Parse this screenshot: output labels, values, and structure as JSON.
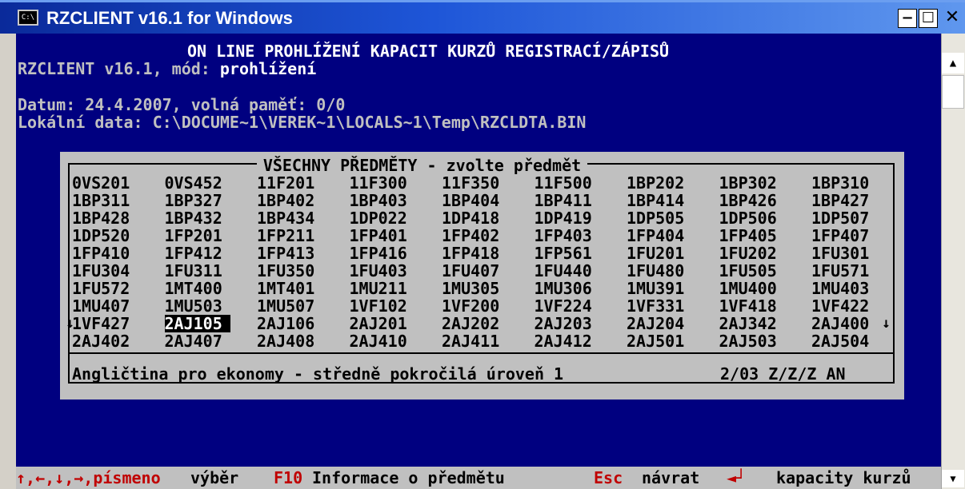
{
  "window": {
    "title": "RZCLIENT v16.1 for Windows",
    "icon_label": "C:\\",
    "min_label": "−",
    "max_label": "☐",
    "close_label": "✕"
  },
  "scrollbar": {
    "up_icon": "▲",
    "down_icon": "▼"
  },
  "header": {
    "line1": "ON LINE PROHLÍŽENÍ KAPACIT KURZŮ REGISTRACÍ/ZÁPISŮ",
    "line2_prefix": "RZCLIENT v16.1, mód: ",
    "line2_value": "prohlížení",
    "line3": "Datum: 24.4.2007, volná paměť: 0/0",
    "line4": "Lokální data: C:\\DOCUME~1\\VEREK~1\\LOCALS~1\\Temp\\RZCLDTA.BIN"
  },
  "dialog": {
    "title": "VŠECHNY PŘEDMĚTY - zvolte předmět",
    "left_arrow": "↓",
    "right_arrow": "↓",
    "selected": "2AJ105",
    "rows": [
      [
        "0VS201",
        "0VS452",
        "11F201",
        "11F300",
        "11F350",
        "11F500",
        "1BP202",
        "1BP302",
        "1BP310"
      ],
      [
        "1BP311",
        "1BP327",
        "1BP402",
        "1BP403",
        "1BP404",
        "1BP411",
        "1BP414",
        "1BP426",
        "1BP427"
      ],
      [
        "1BP428",
        "1BP432",
        "1BP434",
        "1DP022",
        "1DP418",
        "1DP419",
        "1DP505",
        "1DP506",
        "1DP507"
      ],
      [
        "1DP520",
        "1FP201",
        "1FP211",
        "1FP401",
        "1FP402",
        "1FP403",
        "1FP404",
        "1FP405",
        "1FP407"
      ],
      [
        "1FP410",
        "1FP412",
        "1FP413",
        "1FP416",
        "1FP418",
        "1FP561",
        "1FU201",
        "1FU202",
        "1FU301"
      ],
      [
        "1FU304",
        "1FU311",
        "1FU350",
        "1FU403",
        "1FU407",
        "1FU440",
        "1FU480",
        "1FU505",
        "1FU571"
      ],
      [
        "1FU572",
        "1MT400",
        "1MT401",
        "1MU211",
        "1MU305",
        "1MU306",
        "1MU391",
        "1MU400",
        "1MU403"
      ],
      [
        "1MU407",
        "1MU503",
        "1MU507",
        "1VF102",
        "1VF200",
        "1VF224",
        "1VF331",
        "1VF418",
        "1VF422"
      ],
      [
        "1VF427",
        "2AJ105",
        "2AJ106",
        "2AJ201",
        "2AJ202",
        "2AJ203",
        "2AJ204",
        "2AJ342",
        "2AJ400"
      ],
      [
        "2AJ402",
        "2AJ407",
        "2AJ408",
        "2AJ410",
        "2AJ411",
        "2AJ412",
        "2AJ501",
        "2AJ503",
        "2AJ504"
      ]
    ],
    "description": "Angličtina pro ekonomy - středně pokročilá úroveň 1",
    "code": "2/03 Z/Z/Z AN"
  },
  "statusbar": {
    "keys1": "↑,←,↓,→,písmeno",
    "label1": "výběr",
    "keys2": "F10",
    "label2": "Informace o předmětu",
    "keys3": "Esc",
    "label3": "návrat",
    "keys4": "◄┘",
    "label4": "kapacity kurzů"
  }
}
